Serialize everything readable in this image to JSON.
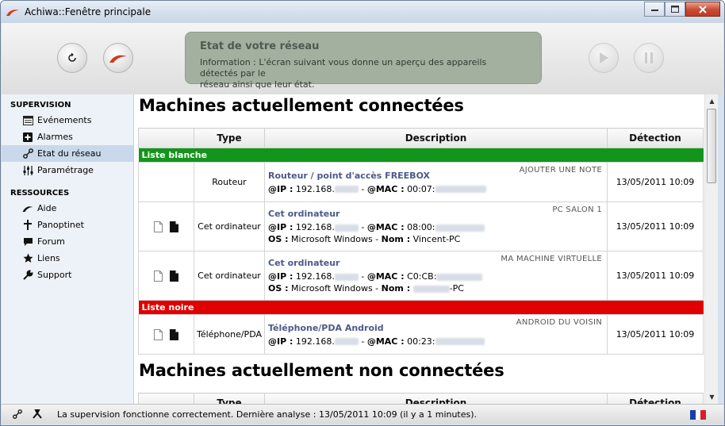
{
  "window": {
    "title": "Achiwa::Fenêtre principale"
  },
  "toolbar": {
    "refresh_button": "refresh-icon",
    "logo_button": "achiwa-logo-icon",
    "play_button": "play-icon",
    "pause_button": "pause-icon"
  },
  "info_panel": {
    "title": "Etat de votre réseau",
    "text_line1": "Information : L'écran suivant vous donne un aperçu des appareils détectés par le",
    "text_line2": "réseau ainsi que leur état."
  },
  "sidebar": {
    "section1": "SUPERVISION",
    "items1": [
      {
        "label": "Evénements",
        "icon": "calendar-icon"
      },
      {
        "label": "Alarmes",
        "icon": "plus-box-icon"
      },
      {
        "label": "Etat du réseau",
        "icon": "network-icon"
      },
      {
        "label": "Paramétrage",
        "icon": "settings-sliders-icon"
      }
    ],
    "section2": "RESSOURCES",
    "items2": [
      {
        "label": "Aide",
        "icon": "achiwa-icon"
      },
      {
        "label": "Panoptinet",
        "icon": "puzzle-icon"
      },
      {
        "label": "Forum",
        "icon": "speech-bubble-icon"
      },
      {
        "label": "Liens",
        "icon": "star-icon"
      },
      {
        "label": "Support",
        "icon": "wrench-icon"
      }
    ],
    "active_item": "Etat du réseau"
  },
  "main": {
    "heading_connected": "Machines actuellement connectées",
    "heading_disconnected": "Machines actuellement non connectées",
    "columns": [
      "",
      "Type",
      "Description",
      "Détection"
    ],
    "whitelist_label": "Liste blanche",
    "blacklist_label": "Liste noire",
    "rows": [
      {
        "type": "Routeur",
        "name": "Routeur / point d'accès FREEBOX",
        "note": "AJOUTER UNE NOTE",
        "ip_label": "@IP :",
        "ip": "192.168.",
        "mac_label": "@MAC :",
        "mac": "00:07:",
        "detection": "13/05/2011 10:09",
        "has_icons": false
      },
      {
        "type": "Cet ordinateur",
        "name": "Cet ordinateur",
        "note": "PC SALON 1",
        "ip_label": "@IP :",
        "ip": "192.168.",
        "mac_label": "@MAC :",
        "mac": "08:00:",
        "os_label": "OS :",
        "os": "Microsoft Windows",
        "nom_label": "Nom :",
        "nom": "Vincent-PC",
        "detection": "13/05/2011 10:09",
        "has_icons": true
      },
      {
        "type": "Cet ordinateur",
        "name": "Cet ordinateur",
        "note": "MA MACHINE VIRTUELLE",
        "ip_label": "@IP :",
        "ip": "192.168.",
        "mac_label": "@MAC :",
        "mac": "C0:CB:",
        "os_label": "OS :",
        "os": "Microsoft Windows",
        "nom_label": "Nom :",
        "nom_suffix": "-PC",
        "detection": "13/05/2011 10:09",
        "has_icons": true
      },
      {
        "type": "Téléphone/PDA",
        "name": "Téléphone/PDA Android",
        "note": "ANDROID DU VOISIN",
        "ip_label": "@IP :",
        "ip": "192.168.",
        "mac_label": "@MAC :",
        "mac": "00:23:",
        "detection": "13/05/2011 10:09",
        "has_icons": true
      }
    ]
  },
  "status": {
    "text": "La supervision fonctionne correctement. Dernière analyse : 13/05/2011 10:09 (il y a 1 minutes).",
    "language_flag": "french-flag-icon"
  },
  "colors": {
    "whitelist": "#13951b",
    "blacklist": "#e00000",
    "info_panel": "#a3b09f",
    "device_name": "#4a5a8a"
  }
}
